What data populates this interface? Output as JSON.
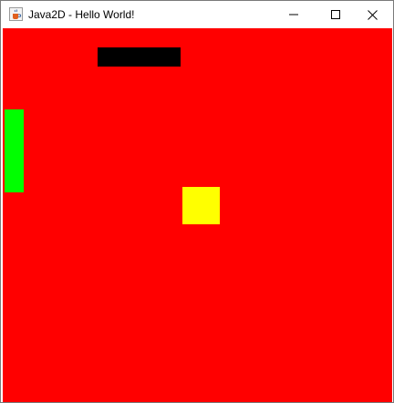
{
  "window": {
    "title": "Java2D - Hello World!",
    "icon": "java-cup-icon",
    "controls": {
      "minimize_icon": "minimize-icon",
      "maximize_icon": "maximize-icon",
      "close_icon": "close-icon"
    }
  },
  "canvas": {
    "background_color": "#ff0000",
    "shapes": [
      {
        "name": "black-bar",
        "color": "#000000"
      },
      {
        "name": "green-paddle",
        "color": "#00ff00"
      },
      {
        "name": "yellow-square",
        "color": "#ffff00"
      }
    ]
  }
}
